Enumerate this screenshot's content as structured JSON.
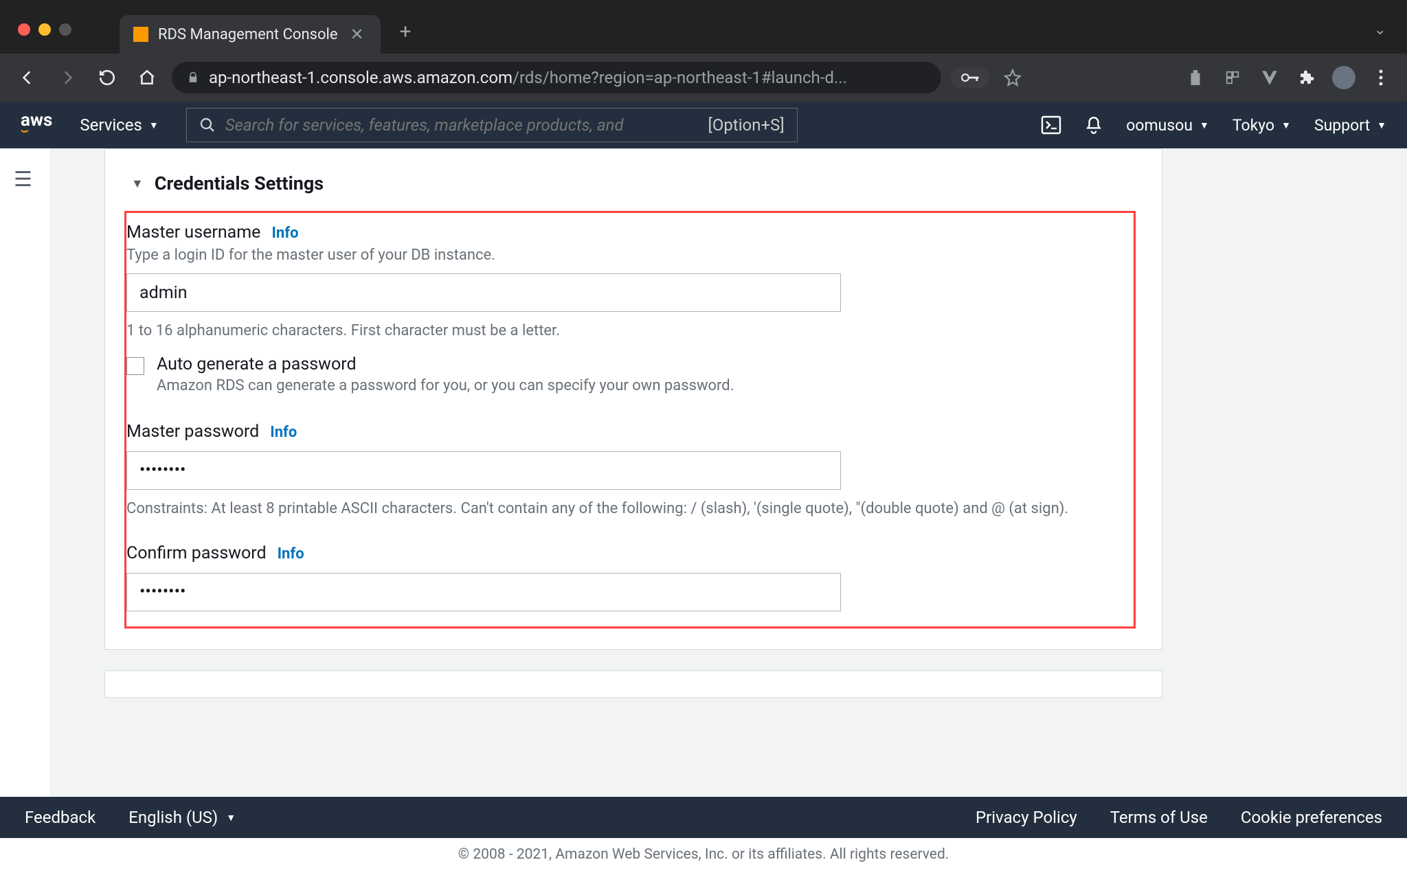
{
  "browser": {
    "tab_title": "RDS Management Console",
    "new_tab": "+",
    "url_scheme_host": "ap-northeast-1.console.aws.amazon.com",
    "url_path": "/rds/home?region=ap-northeast-1#launch-d..."
  },
  "aws_nav": {
    "logo": "aws",
    "services": "Services",
    "search_placeholder": "Search for services, features, marketplace products, and",
    "search_kbd": "[Option+S]",
    "user": "oomusou",
    "region": "Tokyo",
    "support": "Support"
  },
  "section": {
    "title": "Credentials Settings"
  },
  "master_username": {
    "label": "Master username",
    "info": "Info",
    "desc": "Type a login ID for the master user of your DB instance.",
    "value": "admin",
    "constraint": "1 to 16 alphanumeric characters. First character must be a letter."
  },
  "autogen": {
    "label": "Auto generate a password",
    "desc": "Amazon RDS can generate a password for you, or you can specify your own password."
  },
  "master_password": {
    "label": "Master password",
    "info": "Info",
    "value": "••••••••",
    "constraint": "Constraints: At least 8 printable ASCII characters. Can't contain any of the following: / (slash), '(single quote), \"(double quote) and @ (at sign)."
  },
  "confirm_password": {
    "label": "Confirm password",
    "info": "Info",
    "value": "••••••••"
  },
  "footer": {
    "feedback": "Feedback",
    "language": "English (US)",
    "privacy": "Privacy Policy",
    "terms": "Terms of Use",
    "cookies": "Cookie preferences",
    "copyright": "© 2008 - 2021, Amazon Web Services, Inc. or its affiliates. All rights reserved."
  }
}
